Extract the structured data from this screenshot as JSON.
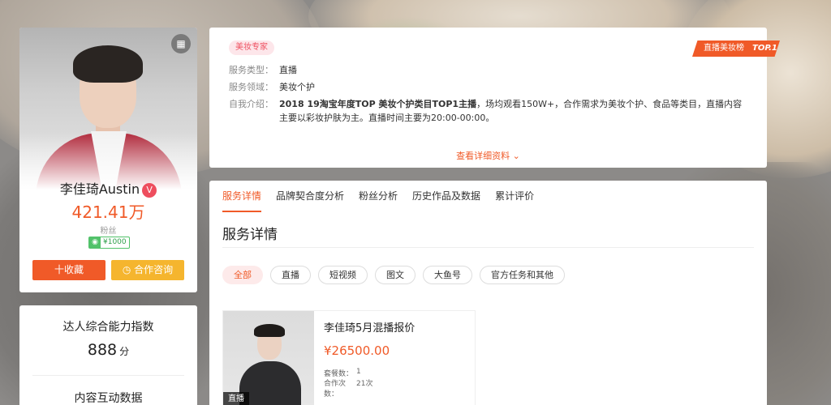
{
  "profile": {
    "name": "李佳琦Austin",
    "verified_mark": "V",
    "followers": "421.41万",
    "followers_label": "粉丝",
    "price_tag": "¥1000",
    "favorite_button": "十收藏",
    "consult_button": "合作咨询"
  },
  "ability": {
    "title": "达人综合能力指数",
    "score": "888",
    "unit": "分",
    "section2_title": "内容互动数据"
  },
  "info": {
    "tag": "美妆专家",
    "ribbon_text": "直播美妆榜",
    "ribbon_rank": "TOP.1",
    "service_type_label": "服务类型：",
    "service_type_value": "直播",
    "service_field_label": "服务领域：",
    "service_field_value": "美妆个护",
    "intro_label": "自我介绍：",
    "intro_bold": "2018 19淘宝年度TOP 美妆个护类目TOP1主播",
    "intro_rest": "，场均观看150W+，合作需求为美妆个护、食品等类目，直播内容主要以彩妆护肤为主。直播时间主要为20:00-00:00。",
    "view_more": "查看详细资料"
  },
  "details": {
    "tabs": [
      {
        "label": "服务详情",
        "active": true
      },
      {
        "label": "品牌契合度分析"
      },
      {
        "label": "粉丝分析"
      },
      {
        "label": "历史作品及数据"
      },
      {
        "label": "累计评价"
      }
    ],
    "section_title": "服务详情",
    "filters": [
      {
        "label": "全部",
        "active": true
      },
      {
        "label": "直播"
      },
      {
        "label": "短视频"
      },
      {
        "label": "图文"
      },
      {
        "label": "大鱼号"
      },
      {
        "label": "官方任务和其他"
      }
    ],
    "product": {
      "image_label": "直播",
      "title": "李佳琦5月混播报价",
      "price": "¥26500.00",
      "package_label": "套餐数：",
      "package_value": "1",
      "coop_label": "合作次数：",
      "coop_value": "21次"
    }
  },
  "colors": {
    "accent": "#f05a28",
    "consult": "#f5b52e",
    "verify": "#ee4e5e"
  }
}
